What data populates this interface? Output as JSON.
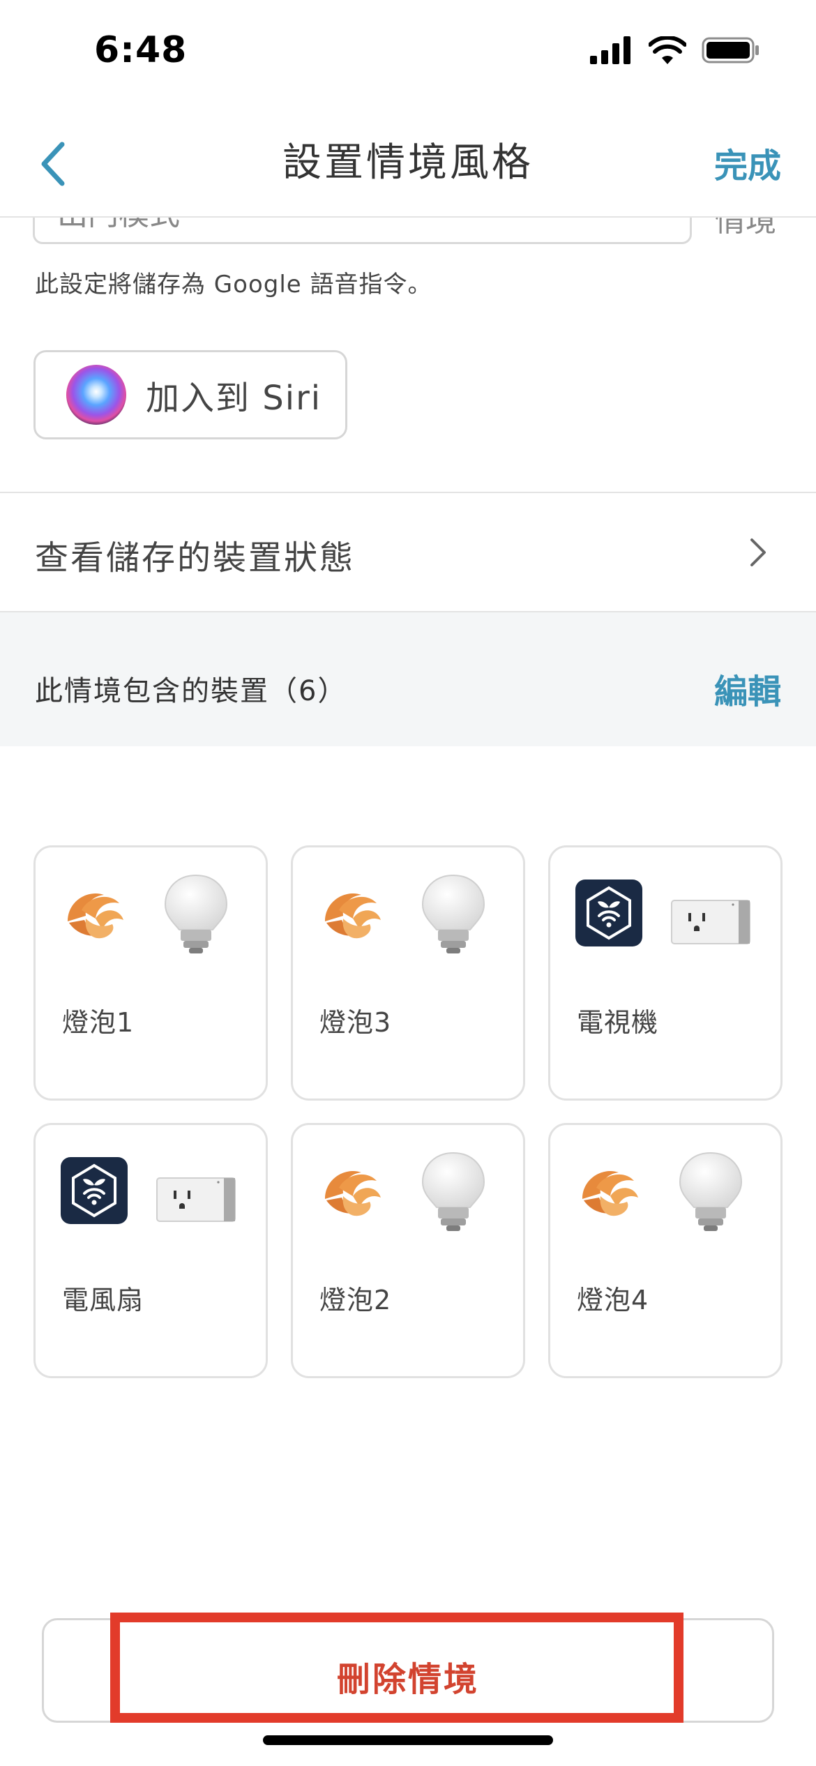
{
  "status_bar": {
    "time": "6:48"
  },
  "nav": {
    "title": "設置情境風格",
    "done_label": "完成"
  },
  "scene": {
    "name_value": "出門模式",
    "name_suffix": "情境",
    "hint": "此設定將儲存為 Google 語音指令。",
    "siri_label": "加入到 Siri"
  },
  "saved_state": {
    "label": "查看儲存的裝置狀態"
  },
  "devices_section": {
    "title": "此情境包含的裝置（6）",
    "edit_label": "編輯"
  },
  "devices": [
    {
      "name": "燈泡1",
      "brand_icon": "flame-logo-icon",
      "device_icon": "light-bulb-icon"
    },
    {
      "name": "燈泡3",
      "brand_icon": "flame-logo-icon",
      "device_icon": "light-bulb-icon"
    },
    {
      "name": "電視機",
      "brand_icon": "hex-wifi-logo-icon",
      "device_icon": "smart-plug-icon"
    },
    {
      "name": "電風扇",
      "brand_icon": "hex-wifi-logo-icon",
      "device_icon": "smart-plug-icon"
    },
    {
      "name": "燈泡2",
      "brand_icon": "flame-logo-icon",
      "device_icon": "light-bulb-icon"
    },
    {
      "name": "燈泡4",
      "brand_icon": "flame-logo-icon",
      "device_icon": "light-bulb-icon"
    }
  ],
  "delete": {
    "label": "刪除情境"
  },
  "colors": {
    "accent": "#3a93b8",
    "danger": "#d2432f",
    "highlight": "#e23b2a",
    "section_bg": "#f4f6f7"
  }
}
